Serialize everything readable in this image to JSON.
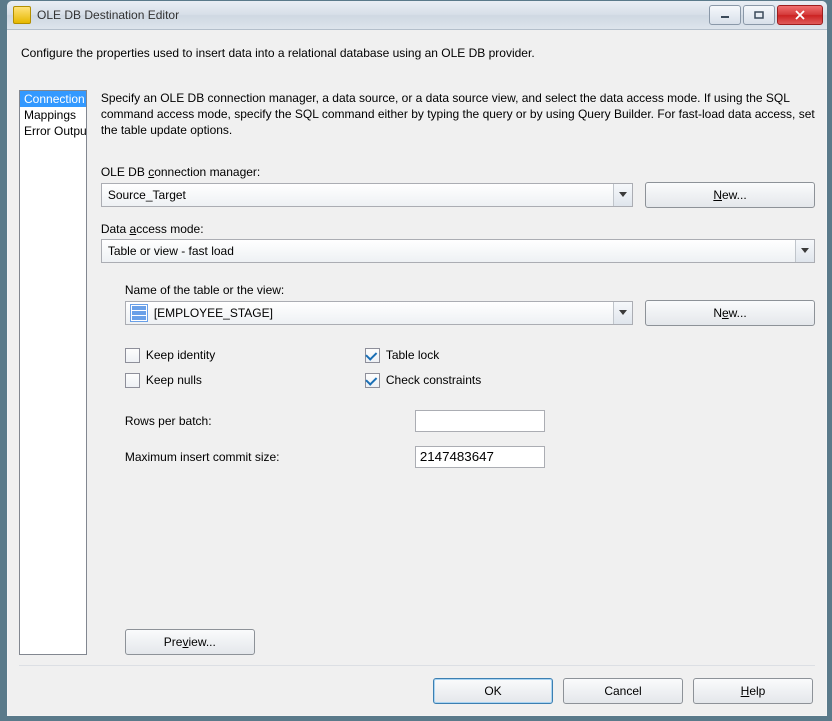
{
  "window": {
    "title": "OLE DB Destination Editor"
  },
  "intro": "Configure the properties used to insert data into a relational database using an OLE DB provider.",
  "nav": {
    "items": [
      {
        "label": "Connection Manager",
        "selected": true
      },
      {
        "label": "Mappings",
        "selected": false
      },
      {
        "label": "Error Output",
        "selected": false
      }
    ]
  },
  "panel": {
    "desc": "Specify an OLE DB connection manager, a data source, or a data source view, and select the data access mode. If using the SQL command access mode, specify the SQL command either by typing the query or by using Query Builder. For fast-load data access, set the table update options.",
    "conn_label_pre": "OLE DB ",
    "conn_label_accel": "c",
    "conn_label_post": "onnection manager:",
    "conn_value": "Source_Target",
    "new_btn": "New...",
    "mode_label_pre": "Data ",
    "mode_label_accel": "a",
    "mode_label_post": "ccess mode:",
    "mode_value": "Table or view - fast load",
    "table_label": "Name of the table or the view:",
    "table_value": "[EMPLOYEE_STAGE]",
    "keep_identity_accel": "K",
    "keep_identity_post": "eep identity",
    "keep_nulls": "Keep nulls",
    "table_lock_pre": "Table loc",
    "table_lock_accel": "k",
    "check_constraints_accel": "h",
    "check_constraints_pre": "C",
    "check_constraints_post": "eck constraints",
    "rows_pre": "",
    "rows_accel": "R",
    "rows_post": "ows per batch:",
    "rows_value": "",
    "max_accel": "M",
    "max_post": "aximum insert commit size:",
    "max_value": "2147483647",
    "preview_pre": "Pre",
    "preview_accel": "v",
    "preview_post": "iew..."
  },
  "footer": {
    "ok": "OK",
    "cancel": "Cancel",
    "help_accel": "H",
    "help_post": "elp"
  }
}
